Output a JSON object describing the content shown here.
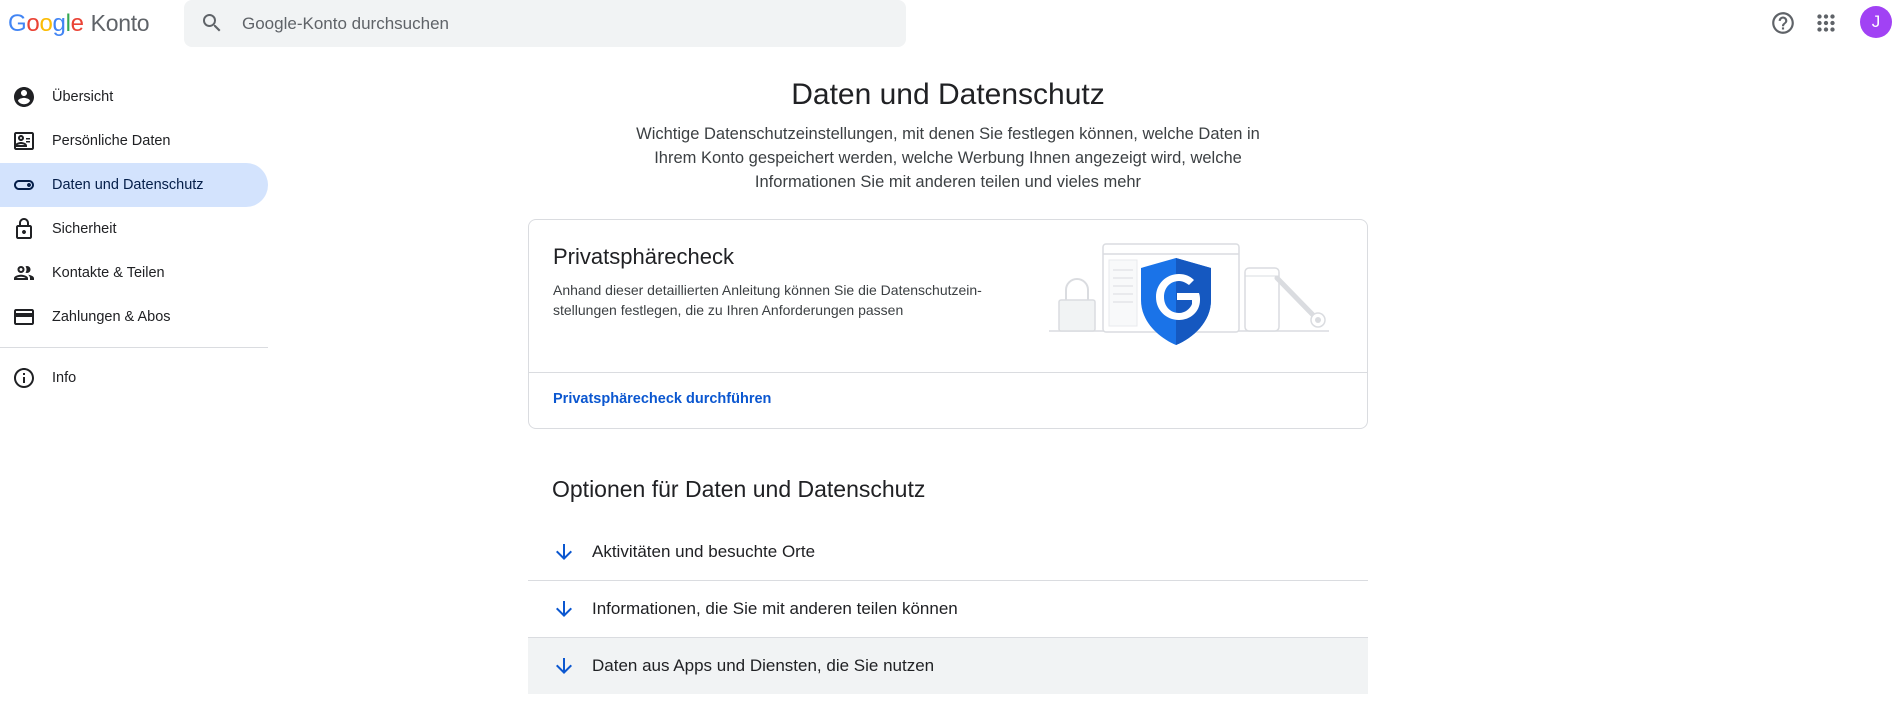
{
  "header": {
    "logo_google": "Google",
    "logo_product": "Konto",
    "search_placeholder": "Google-Konto durchsuchen",
    "avatar_initial": "J",
    "avatar_color": "#a142f4"
  },
  "sidebar": {
    "items": [
      {
        "label": "Übersicht",
        "icon": "account-circle-icon"
      },
      {
        "label": "Persönliche Daten",
        "icon": "id-card-icon"
      },
      {
        "label": "Daten und Datenschutz",
        "icon": "toggle-icon",
        "active": true
      },
      {
        "label": "Sicherheit",
        "icon": "lock-icon"
      },
      {
        "label": "Kontakte & Teilen",
        "icon": "people-icon"
      },
      {
        "label": "Zahlungen & Abos",
        "icon": "credit-card-icon"
      },
      {
        "label": "Info",
        "icon": "info-icon"
      }
    ]
  },
  "main": {
    "title": "Daten und Datenschutz",
    "subtitle": "Wichtige Datenschutzeinstellungen, mit denen Sie festlegen können, welche Daten in Ihrem Konto gespeichert werden, welche Werbung Ihnen angezeigt wird, welche Informationen Sie mit anderen teilen und vieles mehr",
    "privacy_card": {
      "title": "Privatsphärecheck",
      "description": "Anhand dieser detaillierten Anleitung können Sie die Datenschutzein-stellungen festlegen, die zu Ihren Anforderungen passen",
      "link": "Privatsphärecheck durchführen"
    },
    "options_title": "Optionen für Daten und Datenschutz",
    "options": [
      {
        "label": "Aktivitäten und besuchte Orte"
      },
      {
        "label": "Informationen, die Sie mit anderen teilen können"
      },
      {
        "label": "Daten aus Apps und Diensten, die Sie nutzen"
      }
    ]
  },
  "colors": {
    "accent_blue": "#0b57d0",
    "active_nav_bg": "#d3e3fd",
    "shield_blue": "#1a73e8"
  }
}
